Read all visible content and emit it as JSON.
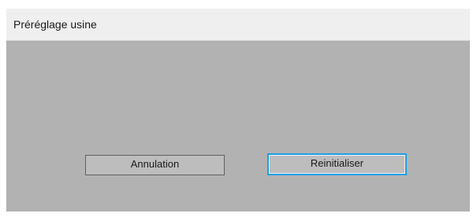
{
  "dialog": {
    "title": "Préréglage usine"
  },
  "buttons": {
    "cancel_label": "Annulation",
    "reset_label": "Reinitialiser"
  },
  "colors": {
    "dialog_background": "#b2b2b2",
    "title_bar_background": "#efefef",
    "focus_border": "#1ea0e6"
  },
  "state": {
    "focused_button": "reset"
  }
}
